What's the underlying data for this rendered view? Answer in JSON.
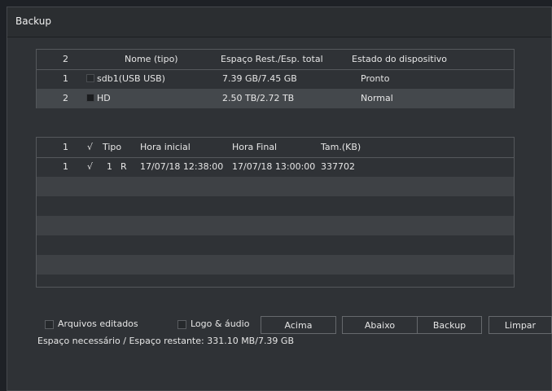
{
  "window": {
    "title": "Backup"
  },
  "devices": {
    "headers": {
      "index": "2",
      "name": "Nome (tipo)",
      "space": "Espaço Rest./Esp. total",
      "status": "Estado do dispositivo"
    },
    "rows": [
      {
        "index": "1",
        "name": "sdb1(USB USB)",
        "space": "7.39 GB/7.45 GB",
        "status": "Pronto"
      },
      {
        "index": "2",
        "name": "HD",
        "space": "2.50 TB/2.72 TB",
        "status": "Normal"
      }
    ]
  },
  "files": {
    "headers": {
      "index": "1",
      "check": "√",
      "type": "Tipo",
      "start": "Hora inicial",
      "end": "Hora Final",
      "size": "Tam.(KB)"
    },
    "rows": [
      {
        "index": "1",
        "check": "√",
        "channel": "1",
        "type": "R",
        "start": "17/07/18 12:38:00",
        "end": "17/07/18 13:00:00",
        "size": "337702"
      }
    ]
  },
  "options": {
    "edited_files": "Arquivos editados",
    "logo_audio": "Logo & áudio"
  },
  "buttons": {
    "up": "Acima",
    "down": "Abaixo",
    "backup": "Backup",
    "clear": "Limpar"
  },
  "status": {
    "space_text": "Espaço necessário / Espaço restante: 331.10 MB/7.39 GB"
  }
}
